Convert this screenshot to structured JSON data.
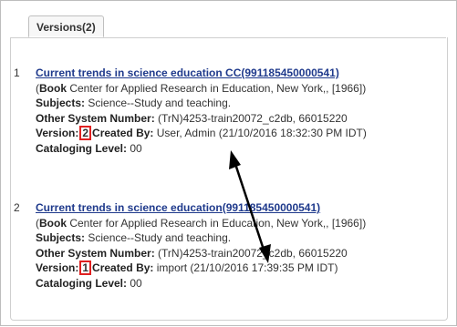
{
  "tab": {
    "label": "Versions(2)"
  },
  "records": [
    {
      "index": "1",
      "title": "Current trends in science education CC(991185450000541)",
      "open_paren": "(",
      "type_label": "Book",
      "publisher": " Center for Applied Research in Education, New York,, [1966])",
      "subjects_label": "Subjects:",
      "subjects_value": " Science--Study and teaching.",
      "other_label": "Other System Number:",
      "other_value": " (TrN)4253-train20072_c2db, 66015220",
      "version_label": "Version:",
      "version_value": "2",
      "created_label": "Created By:",
      "created_value": " User, Admin (21/10/2016 18:32:30 PM IDT)",
      "cataloging_label": "Cataloging Level:",
      "cataloging_value": " 00"
    },
    {
      "index": "2",
      "title": "Current trends in science education(991185450000541)",
      "open_paren": "(",
      "type_label": "Book",
      "publisher": " Center for Applied Research in Education, New York,, [1966])",
      "subjects_label": "Subjects:",
      "subjects_value": " Science--Study and teaching.",
      "other_label": "Other System Number:",
      "other_value": " (TrN)4253-train20072_c2db, 66015220",
      "version_label": "Version:",
      "version_value": "1",
      "created_label": "Created By:",
      "created_value": " import (21/10/2016 17:39:35 PM IDT)",
      "cataloging_label": "Cataloging Level:",
      "cataloging_value": " 00"
    }
  ],
  "colors": {
    "link": "#1f3a8c",
    "highlight_box": "#e02020",
    "arrow": "#000000"
  }
}
